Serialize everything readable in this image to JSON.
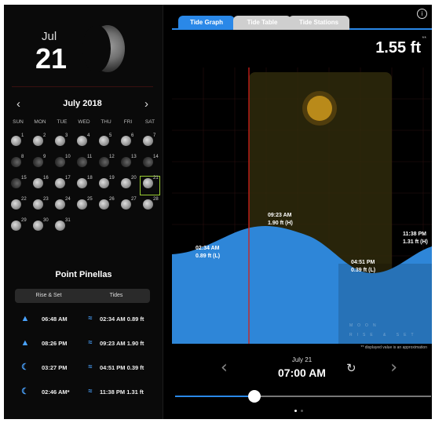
{
  "header": {
    "month_short": "Jul",
    "day": "21"
  },
  "calendar": {
    "title": "July 2018",
    "prev": "‹",
    "next": "›",
    "weekdays": [
      "SUN",
      "MON",
      "TUE",
      "WED",
      "THU",
      "FRI",
      "SAT"
    ],
    "days": [
      {
        "d": "1"
      },
      {
        "d": "2"
      },
      {
        "d": "3"
      },
      {
        "d": "4"
      },
      {
        "d": "5"
      },
      {
        "d": "6"
      },
      {
        "d": "7"
      },
      {
        "d": "8"
      },
      {
        "d": "9"
      },
      {
        "d": "10"
      },
      {
        "d": "11"
      },
      {
        "d": "12"
      },
      {
        "d": "13"
      },
      {
        "d": "14"
      },
      {
        "d": "15"
      },
      {
        "d": "16"
      },
      {
        "d": "17"
      },
      {
        "d": "18"
      },
      {
        "d": "19"
      },
      {
        "d": "20"
      },
      {
        "d": "21"
      },
      {
        "d": "22"
      },
      {
        "d": "23"
      },
      {
        "d": "24"
      },
      {
        "d": "25"
      },
      {
        "d": "26"
      },
      {
        "d": "27"
      },
      {
        "d": "28"
      },
      {
        "d": "29"
      },
      {
        "d": "30"
      },
      {
        "d": "31"
      }
    ],
    "selected": "21"
  },
  "location": "Point Pinellas",
  "segments": [
    "Rise & Set",
    "Tides"
  ],
  "events": [
    {
      "time1": "06:48 AM",
      "time2": "02:34 AM",
      "val": "0.89 ft"
    },
    {
      "time1": "08:26 PM",
      "time2": "09:23 AM",
      "val": "1.90 ft"
    },
    {
      "time1": "03:27 PM",
      "time2": "04:51 PM",
      "val": "0.39 ft"
    },
    {
      "time1": "02:46 AM*",
      "time2": "11:38 PM",
      "val": "1.31 ft"
    }
  ],
  "tabs": [
    "Tide Graph",
    "Tide Table",
    "Tide Stations"
  ],
  "info_icon": "i",
  "current_height": "1.55 ft",
  "height_mark": "**",
  "graph": {
    "moon_label": "MOON",
    "rise_set_label": "RISE & SET",
    "labels": [
      {
        "time": "02:34 AM",
        "val": "0.89 ft (L)"
      },
      {
        "time": "09:23 AM",
        "val": "1.90 ft (H)"
      },
      {
        "time": "04:51 PM",
        "val": "0.39 ft (L)"
      },
      {
        "time": "11:38 PM",
        "val": "1.31 ft (H)"
      }
    ],
    "accent": "#2a88e8",
    "water": "#2e86d8"
  },
  "footer": {
    "note": "** displayed value is an approximation",
    "date": "July 21",
    "time": "07:00 AM",
    "prev": "‹",
    "next": "›",
    "refresh": "↻",
    "slider_fraction": 0.29
  }
}
